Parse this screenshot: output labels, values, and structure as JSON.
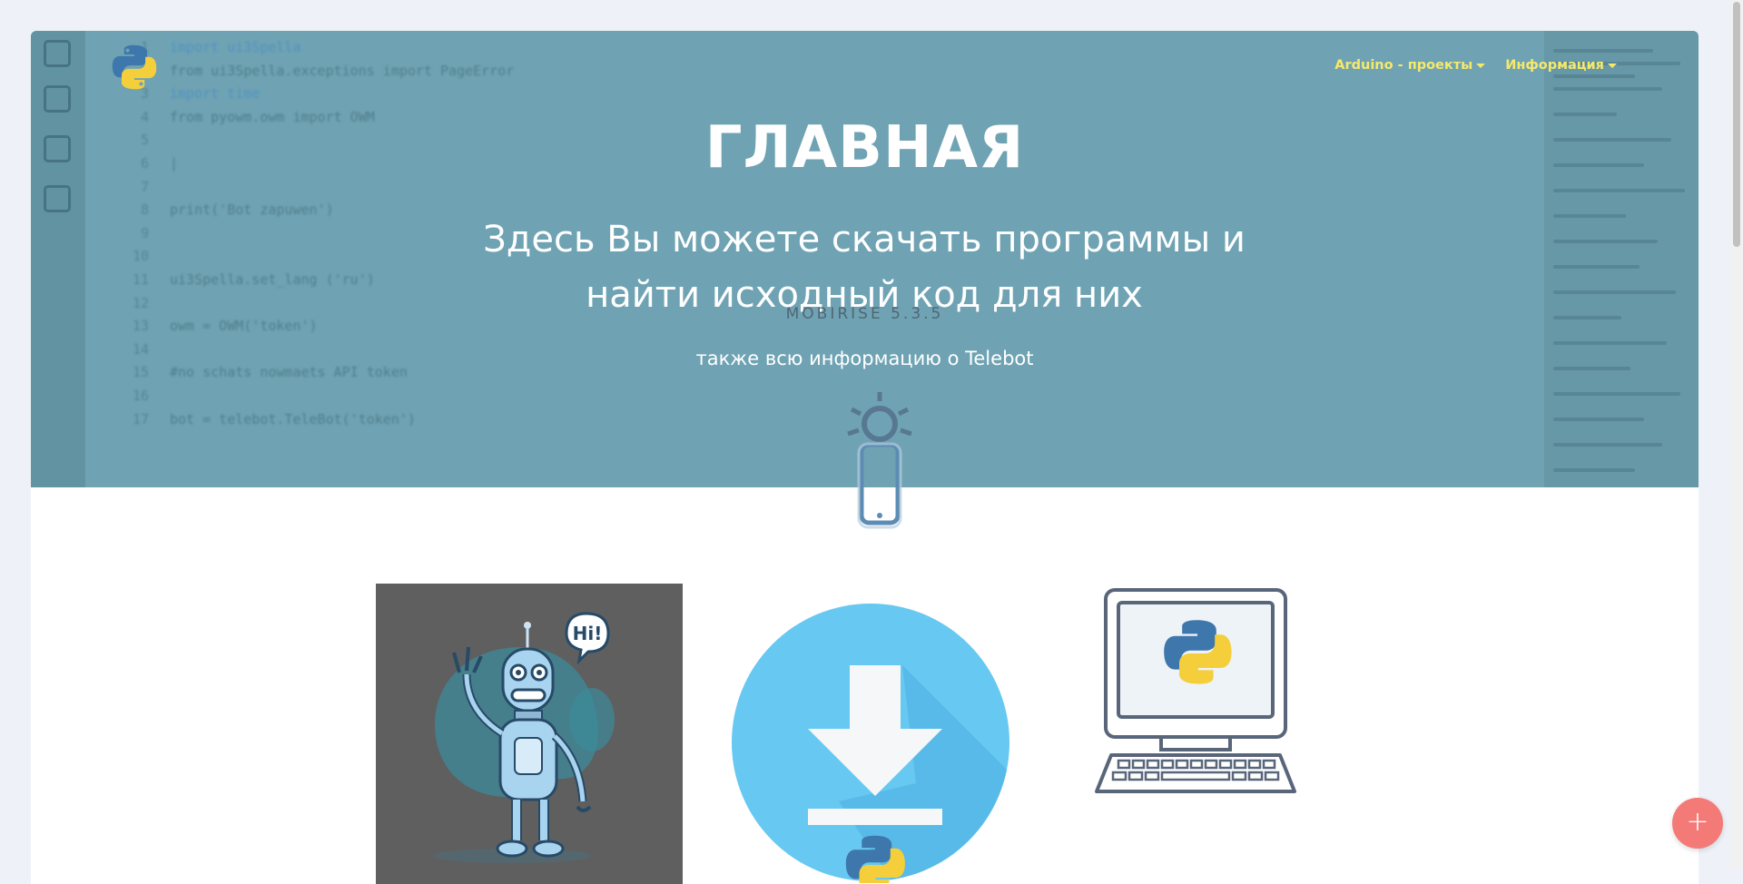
{
  "brand": {
    "logo_icon": "python-logo-icon"
  },
  "nav": [
    {
      "label": "Arduino - проекты",
      "icon": "caret-down-icon"
    },
    {
      "label": "Информация",
      "icon": "caret-down-icon"
    }
  ],
  "hero": {
    "title": "ГЛАВНАЯ",
    "subtitle_line1": "Здесь Вы можете скачать программы и",
    "subtitle_line2": "найти исходный код для них",
    "watermark": "MOBIRISE 5.3.5",
    "tagline": "также всю информацию о Telebot"
  },
  "code_background": {
    "line_numbers": [
      "1",
      "2",
      "3",
      "4",
      "5",
      "6",
      "7",
      "8",
      "9",
      "10",
      "11",
      "12",
      "13",
      "14",
      "15",
      "16",
      "17"
    ],
    "lines": [
      "import ui3Spella",
      "from ui3Spella.exceptions import PageError",
      "import time",
      "from pyowm.owm import OWM",
      "",
      "|",
      "",
      "print('Bot zapuwen')",
      "",
      "",
      "ui3Spella.set_lang ('ru')",
      "",
      "owm = OWM('token')",
      "",
      "#no schats nowmaets API token",
      "",
      "bot = telebot.TeleBot('token')"
    ]
  },
  "features": [
    {
      "name": "robot-hi-illustration",
      "bubble": "Hi!"
    },
    {
      "name": "download-python-icon"
    },
    {
      "name": "computer-python-icon"
    }
  ],
  "fab": {
    "icon": "plus-icon",
    "symbol": "+"
  },
  "colors": {
    "hero_bg": "#6fa3b3",
    "nav_text": "#f6e96a",
    "fab": "#f47a78",
    "download_circle": "#67c8f1",
    "page_bg": "#eef2f8"
  }
}
